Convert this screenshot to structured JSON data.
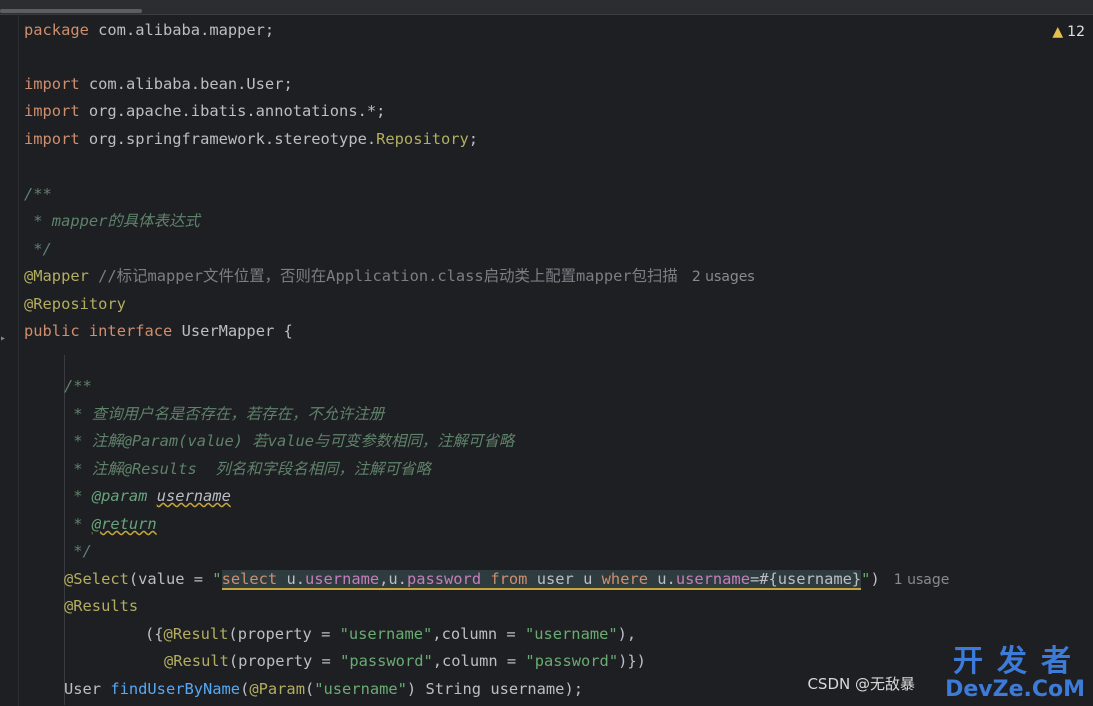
{
  "inspection": {
    "warning_count": "12"
  },
  "code": {
    "l1": {
      "kw": "package",
      "rest": " com.alibaba.mapper;"
    },
    "l3": {
      "kw": "import",
      "rest": " com.alibaba.bean.User;"
    },
    "l4": {
      "kw": "import",
      "rest": " org.apache.ibatis.annotations.*;"
    },
    "l5": {
      "kw": "import",
      "rest": " org.springframework.stereotype.",
      "cls": "Repository",
      "end": ";"
    },
    "l7": "/**",
    "l8": " * mapper的具体表达式",
    "l9": " */",
    "l10": {
      "ann": "@Mapper",
      "cmt": " //标记mapper文件位置，否则在Application.class启动类上配置mapper包扫描",
      "hint": "2 usages"
    },
    "l11": {
      "ann": "@Repository"
    },
    "l12": {
      "kw1": "public",
      "kw2": "interface",
      "name": " UserMapper {"
    },
    "l14": "/**",
    "l15": " * 查询用户名是否存在，若存在，不允许注册",
    "l16": " * 注解@Param(value) 若value与可变参数相同，注解可省略",
    "l17": " * 注解@Results  列名和字段名相同，注解可省略",
    "l18": {
      "prefix": " * ",
      "tag": "@param",
      "ref": "username"
    },
    "l19": {
      "prefix": " * ",
      "tag": "@return"
    },
    "l20": " */",
    "l21": {
      "ann": "@Select",
      "pre": "(value = ",
      "q1": "\"",
      "sql": [
        "select",
        "u.",
        "username",
        ",u.",
        "password",
        "from",
        "user",
        "u",
        "where",
        "u.",
        "username",
        "=#{username}"
      ],
      "q2": "\"",
      "post": ")",
      "hint": "1 usage"
    },
    "l22": {
      "ann": "@Results"
    },
    "l23": {
      "open": "({",
      "ann": "@Result",
      "p1": "(property = ",
      "s1": "\"username\"",
      "p2": ",column = ",
      "s2": "\"username\"",
      "p3": "),"
    },
    "l24": {
      "ann": "@Result",
      "p1": "(property = ",
      "s1": "\"password\"",
      "p2": ",column = ",
      "s2": "\"password\"",
      "p3": ")})"
    },
    "l25": {
      "type": "User ",
      "fn": "findUserByName",
      "open": "(",
      "ann": "@Param",
      "p1": "(",
      "s1": "\"username\"",
      "p2": ") String username);"
    }
  },
  "watermark": {
    "csdn": "CSDN @无敌暴",
    "big": "开发者",
    "site": "DevZe.CoM"
  },
  "colors": {
    "background": "#1e1f22",
    "keyword": "#cf8e6d",
    "annotation": "#b3ae60",
    "string": "#6aab73",
    "doc": "#5f826b"
  }
}
